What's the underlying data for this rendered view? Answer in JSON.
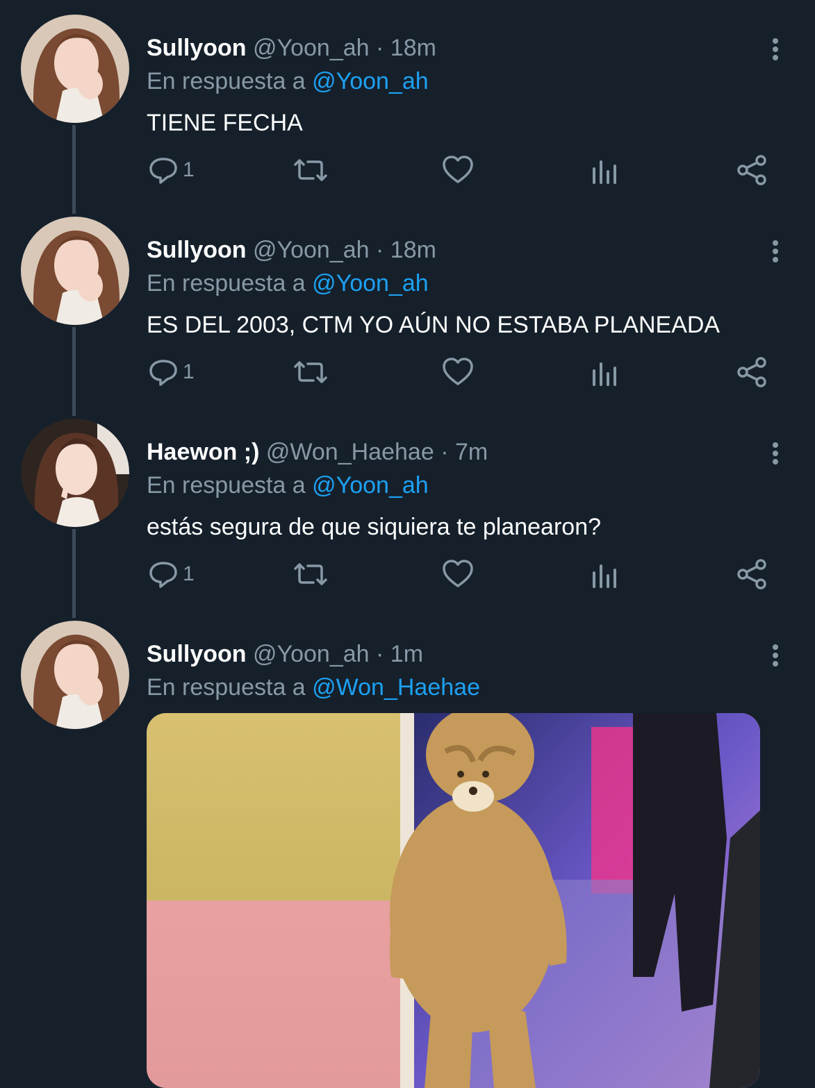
{
  "reply_prefix": "En respuesta a",
  "colors": {
    "background": "#15202b",
    "muted": "#8899a6",
    "link": "#1da1f2",
    "thread_line": "#3d4a57"
  },
  "icons": {
    "reply": "reply-icon",
    "retweet": "retweet-icon",
    "like": "like-icon",
    "analytics": "analytics-icon",
    "share": "share-icon",
    "more": "more-options-icon"
  },
  "tweets": [
    {
      "name": "Sullyoon",
      "handle": "@Yoon_ah",
      "time": "18m",
      "reply_to": "@Yoon_ah",
      "text": "TIENE FECHA",
      "reply_count": "1"
    },
    {
      "name": "Sullyoon",
      "handle": "@Yoon_ah",
      "time": "18m",
      "reply_to": "@Yoon_ah",
      "text": "ES DEL 2003, CTM YO AÚN NO ESTABA PLANEADA",
      "reply_count": "1"
    },
    {
      "name": "Haewon ;)",
      "handle": "@Won_Haehae",
      "time": "7m",
      "reply_to": "@Yoon_ah",
      "text": "estás segura de que siquiera te planearon?",
      "reply_count": "1"
    },
    {
      "name": "Sullyoon",
      "handle": "@Yoon_ah",
      "time": "1m",
      "reply_to": "@Won_Haehae",
      "text": ""
    }
  ],
  "separator": "·"
}
